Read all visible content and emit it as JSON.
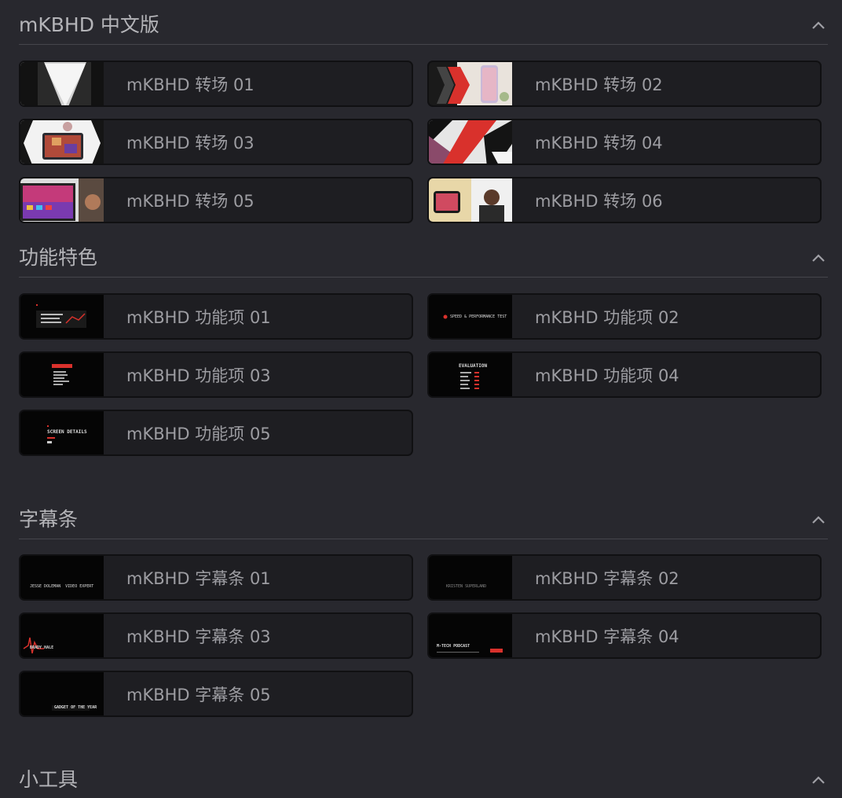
{
  "sections": [
    {
      "title": "mKBHD 中文版",
      "items": [
        "mKBHD 转场 01",
        "mKBHD 转场 02",
        "mKBHD 转场 03",
        "mKBHD 转场 04",
        "mKBHD 转场 05",
        "mKBHD 转场 06"
      ]
    },
    {
      "title": "功能特色",
      "items": [
        "mKBHD 功能项 01",
        "mKBHD 功能项 02",
        "mKBHD 功能项 03",
        "mKBHD 功能项 04",
        "mKBHD 功能项 05"
      ]
    },
    {
      "title": "字幕条",
      "items": [
        "mKBHD 字幕条 01",
        "mKBHD 字幕条 02",
        "mKBHD 字幕条 03",
        "mKBHD 字幕条 04",
        "mKBHD 字幕条 05"
      ]
    },
    {
      "title": "小工具",
      "items": []
    }
  ],
  "thumbnail_text": {
    "feature_02": "SPEED & PERFORMANCE TEST",
    "feature_04": "EVALUATION",
    "feature_05": "SCREEN DETAILS",
    "subtitle_01": "JESSE DOLEMAN  VIDEO EXPERT",
    "subtitle_02": "KRISTEN SUPERLAND",
    "subtitle_03": "BRADY HALE",
    "subtitle_04": "M-TECH PODCAST",
    "subtitle_05": "GADGET OF THE YEAR"
  },
  "icons": {
    "collapse": "chevron-up-icon"
  },
  "colors": {
    "background": "#28282e",
    "card": "#1e1e22",
    "accent_red": "#d9312c"
  }
}
